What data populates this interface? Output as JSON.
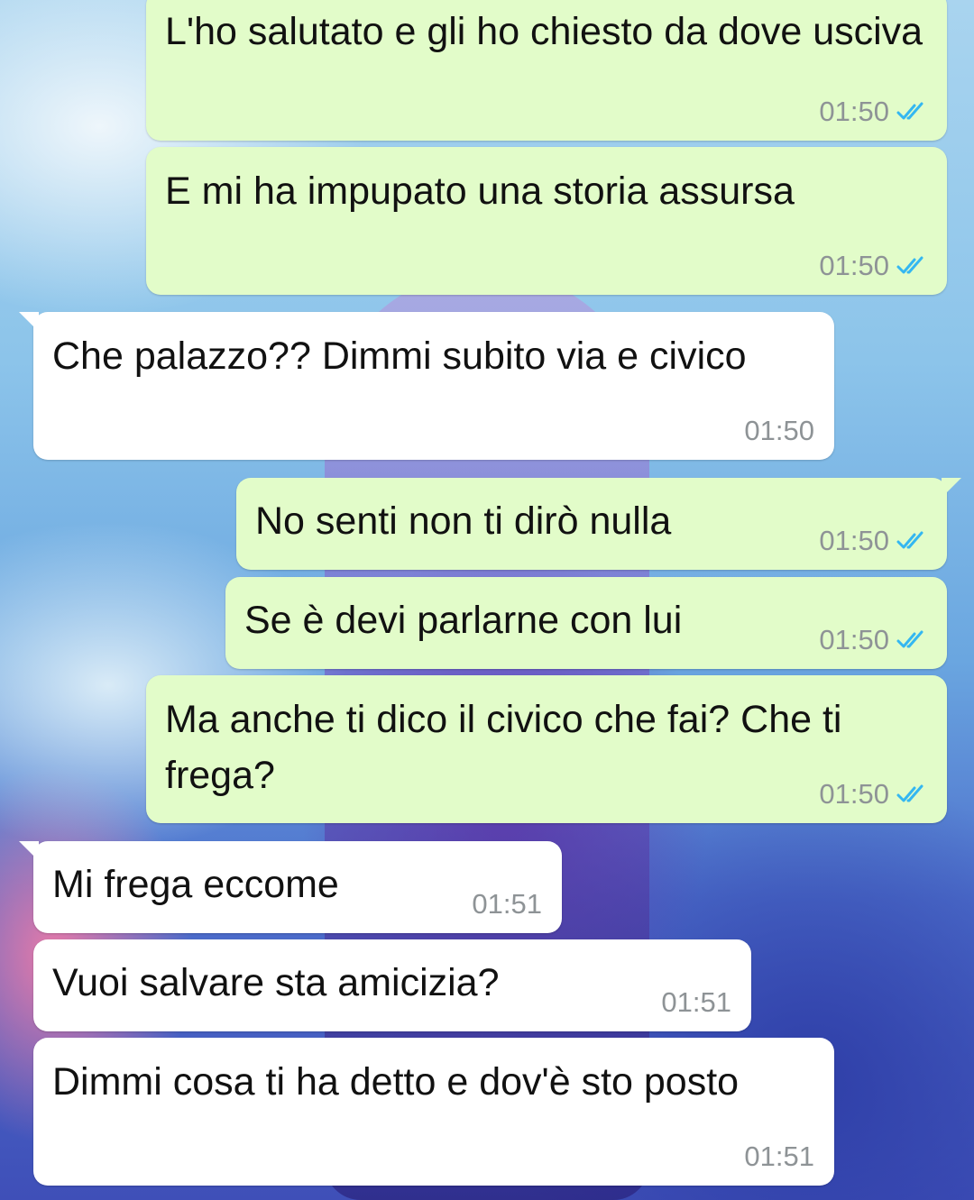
{
  "colors": {
    "outgoing_bubble": "#e2fcc9",
    "incoming_bubble": "#ffffff",
    "timestamp": "#8e9396",
    "read_ticks": "#34b7f1"
  },
  "messages": [
    {
      "direction": "outgoing",
      "text": "L'ho salutato e gli ho chiesto da dove usciva",
      "time": "01:50",
      "status": "read"
    },
    {
      "direction": "outgoing",
      "text": "E mi ha impupato una storia assursa",
      "time": "01:50",
      "status": "read"
    },
    {
      "direction": "incoming",
      "text": "Che palazzo?? Dimmi subito via e civico",
      "time": "01:50"
    },
    {
      "direction": "outgoing",
      "text": "No senti non ti dirò nulla",
      "time": "01:50",
      "status": "read"
    },
    {
      "direction": "outgoing",
      "text": "Se è devi parlarne con lui",
      "time": "01:50",
      "status": "read"
    },
    {
      "direction": "outgoing",
      "text": "Ma anche ti dico il civico che fai? Che ti frega?",
      "time": "01:50",
      "status": "read"
    },
    {
      "direction": "incoming",
      "text": "Mi frega eccome",
      "time": "01:51"
    },
    {
      "direction": "incoming",
      "text": "Vuoi salvare sta amicizia?",
      "time": "01:51"
    },
    {
      "direction": "incoming",
      "text": "Dimmi cosa ti ha detto e dov'è sto posto",
      "time": "01:51"
    }
  ]
}
